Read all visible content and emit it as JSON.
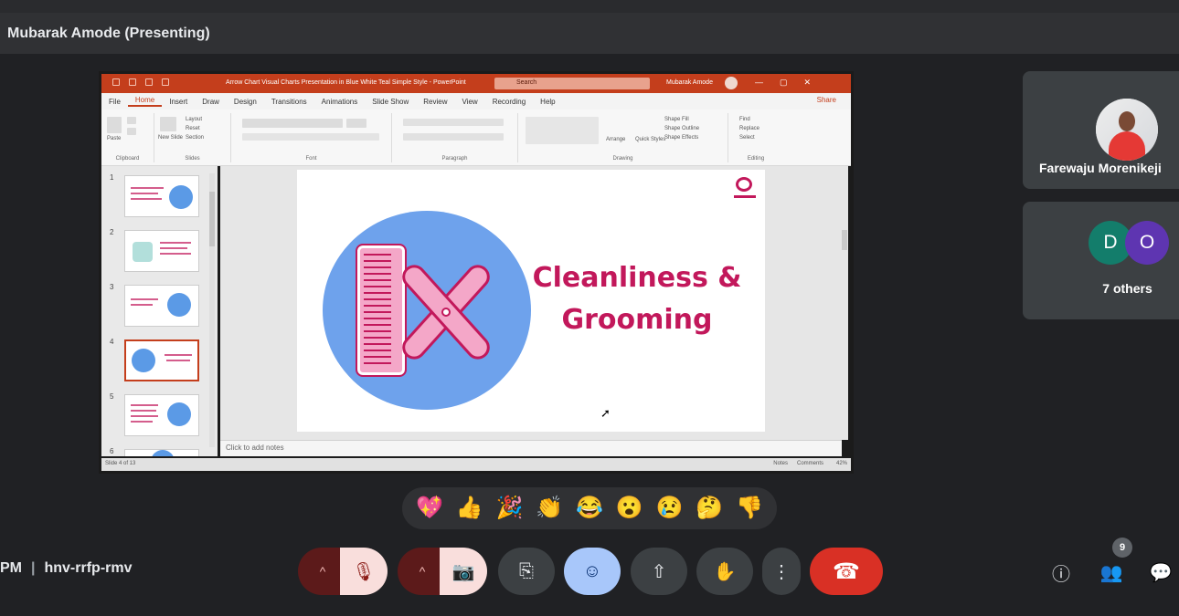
{
  "presenter": {
    "label": "Mubarak Amode (Presenting)"
  },
  "powerpoint": {
    "title": "Arrow Chart Visual Charts Presentation in Blue White Teal Simple Style - PowerPoint",
    "search_placeholder": "Search",
    "user_name": "Mubarak Amode",
    "window_controls": [
      "—",
      "▢",
      "✕"
    ],
    "tabs": [
      "File",
      "Home",
      "Insert",
      "Draw",
      "Design",
      "Transitions",
      "Animations",
      "Slide Show",
      "Review",
      "View",
      "Recording",
      "Help"
    ],
    "active_tab": "Home",
    "share_label": "Share",
    "ribbon_groups": [
      "Clipboard",
      "Slides",
      "Font",
      "Paragraph",
      "Drawing",
      "Editing"
    ],
    "ribbon_items": {
      "paste": "Paste",
      "new_slide": "New Slide",
      "layout": "Layout",
      "reset": "Reset",
      "section": "Section",
      "arrange": "Arrange",
      "quick_styles": "Quick Styles",
      "shape_fill": "Shape Fill",
      "shape_outline": "Shape Outline",
      "shape_effects": "Shape Effects",
      "find": "Find",
      "replace": "Replace",
      "select": "Select"
    },
    "slide_numbers": [
      "1",
      "2",
      "3",
      "4",
      "5",
      "6"
    ],
    "selected_slide": 4,
    "slide_title_line1": "Cleanliness &",
    "slide_title_line2": "Grooming",
    "notes_placeholder": "Click to add notes",
    "status_left": "Slide 4 of 13",
    "status_notes": "Notes",
    "status_comments": "Comments",
    "zoom": "42%"
  },
  "participants": {
    "tile1_name": "Farewaju Morenikeji",
    "chip1": "D",
    "chip2": "O",
    "others_label": "7 others",
    "count_badge": "9"
  },
  "reactions": [
    "💖",
    "👍",
    "🎉",
    "👏",
    "😂",
    "😮",
    "😢",
    "🤔",
    "👎"
  ],
  "meeting": {
    "time_fragment": "PM",
    "code": "hnv-rrfp-rmv"
  },
  "controls": {
    "caret": "^",
    "mic_icon": "🎙",
    "cam_icon": "📷",
    "captions_icon": "⎘",
    "react_icon": "☺",
    "present_icon": "⇧",
    "hand_icon": "✋",
    "more_icon": "⋮",
    "end_icon": "☎"
  },
  "right_icons": {
    "info": "ⓘ",
    "people": "👥",
    "chat": "💬"
  },
  "colors": {
    "accent_pink": "#c2185b",
    "ppt_orange": "#c43e1c",
    "end_red": "#d93025",
    "react_blue": "#a8c7fa"
  }
}
